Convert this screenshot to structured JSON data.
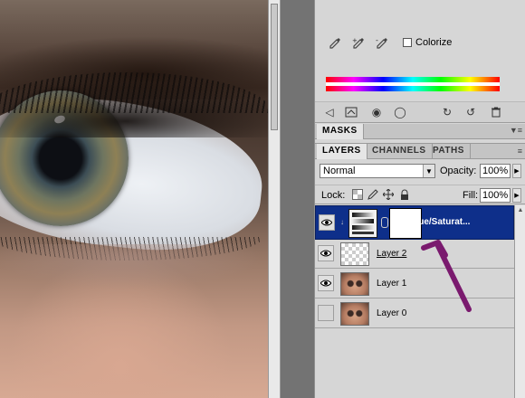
{
  "adjustments": {
    "colorize_label": "Colorize",
    "colorize_checked": false
  },
  "masks_panel": {
    "tab_label": "MASKS"
  },
  "layers_panel": {
    "tabs": [
      {
        "label": "LAYERS",
        "active": true
      },
      {
        "label": "CHANNELS",
        "active": false
      },
      {
        "label": "PATHS",
        "active": false
      }
    ],
    "blend_mode": "Normal",
    "opacity_label": "Opacity:",
    "opacity_value": "100%",
    "lock_label": "Lock:",
    "fill_label": "Fill:",
    "fill_value": "100%",
    "layers": [
      {
        "name": "Hue/Saturat...",
        "visible": true,
        "selected": true,
        "type": "adjustment"
      },
      {
        "name": "Layer 2",
        "visible": true,
        "selected": false,
        "type": "empty"
      },
      {
        "name": "Layer 1",
        "visible": true,
        "selected": false,
        "type": "image"
      },
      {
        "name": "Layer 0",
        "visible": false,
        "selected": false,
        "type": "image"
      }
    ]
  },
  "colors": {
    "selected_layer": "#0e2f8a",
    "annotation_arrow": "#7a1a6e",
    "panel_bg": "#d6d6d6"
  },
  "icons": {
    "eyedroppers": [
      "eyedropper-icon",
      "eyedropper-plus-icon",
      "eyedropper-minus-icon"
    ],
    "adjustment_toolbar": [
      "back-arrow-icon",
      "clip-to-layer-icon",
      "visibility-eye-small-icon",
      "view-previous-icon",
      "reset-icon",
      "trash-icon"
    ],
    "locks": [
      "lock-transparent-icon",
      "lock-paint-icon",
      "lock-position-icon",
      "lock-all-icon"
    ]
  }
}
